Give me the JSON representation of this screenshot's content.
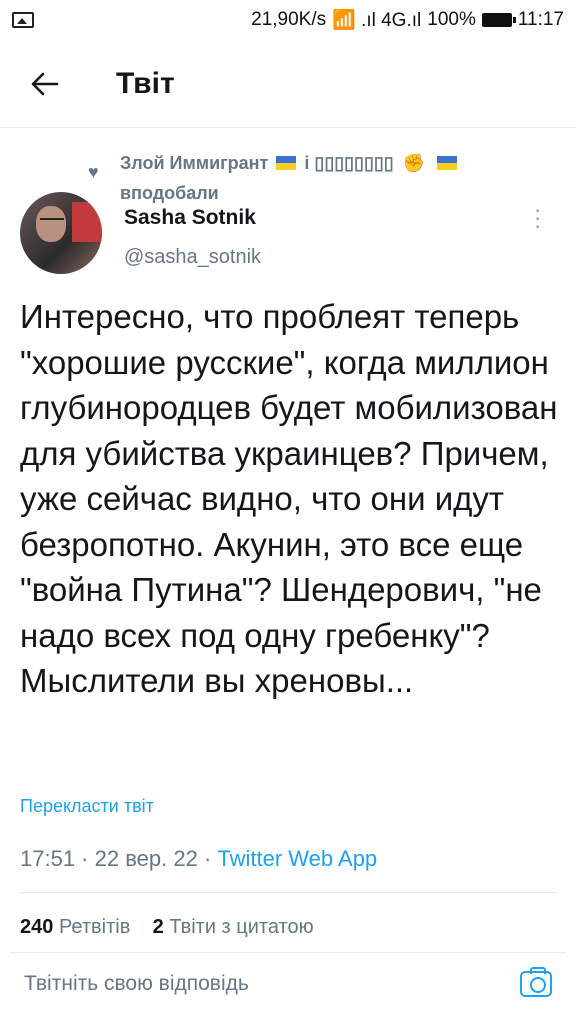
{
  "status_bar": {
    "net_speed": "21,90K/s",
    "signal": "📶 .ıl 4G.ıl",
    "battery_percent": "100%",
    "time": "11:17"
  },
  "header": {
    "title": "Твіт"
  },
  "liked_by": {
    "user": "Злой Иммигрант",
    "connector": "і",
    "other_user": "▯▯▯▯▯▯▯▯",
    "label": "вподобали"
  },
  "author": {
    "name": "Sasha Sotnik",
    "handle": "@sasha_sotnik"
  },
  "tweet": {
    "text": "Интересно, что проблеят теперь \"хорошие русские\", когда миллион глубинородцев будет мобилизован для убийства украинцев? Причем, уже сейчас видно, что они идут безропотно. Акунин, это все еще \"война Путина\"? Шендерович, \"не надо всех под одну гребенку\"? Мыслители вы хреновы...",
    "translate": "Перекласти твіт",
    "time": "17:51",
    "date": "22 вер. 22",
    "client": "Twitter Web App"
  },
  "stats": {
    "retweets_count": "240",
    "retweets_label": "Ретвітів",
    "quotes_count": "2",
    "quotes_label": "Твіти з цитатою"
  },
  "reply": {
    "placeholder": "Твітніть свою відповідь"
  },
  "colors": {
    "accent": "#1da1f2",
    "muted": "#657786",
    "flag_blue": "#3b6fd0",
    "flag_yellow": "#f5cf1b"
  }
}
